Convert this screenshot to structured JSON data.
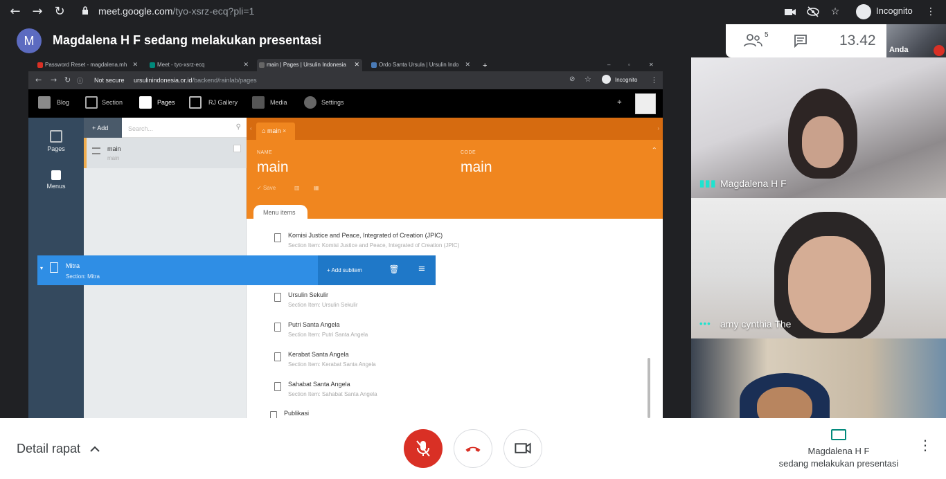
{
  "browser": {
    "url_host": "meet.google.com",
    "url_path": "/tyo-xsrz-ecq?pli=1",
    "incognito_label": "Incognito",
    "icons": [
      "back-icon",
      "forward-icon",
      "reload-icon",
      "lock-icon",
      "camera-icon",
      "eye-off-icon",
      "star-icon",
      "incognito-icon",
      "kebab-icon"
    ]
  },
  "meet": {
    "avatar_letter": "M",
    "title": "Magdalena H F sedang melakukan presentasi",
    "people_count": "5",
    "clock": "13.42",
    "self_label": "Anda",
    "participants": [
      {
        "name": "Magdalena H F"
      },
      {
        "name": "amy cynthia The"
      },
      {
        "name": ""
      }
    ],
    "bottom": {
      "details_label": "Detail rapat",
      "presenter_name": "Magdalena H F",
      "presenter_sub": "sedang melakukan presentasi"
    },
    "colors": {
      "mic_off": "#d93025",
      "hangup": "#d93025",
      "accent": "#00897b"
    }
  },
  "shared": {
    "tabs": [
      {
        "label": "Password Reset - magdalena.mh",
        "fav": "#d93025"
      },
      {
        "label": "Meet - tyo-xsrz-ecq",
        "fav": "#00897b"
      },
      {
        "label": "main | Pages | Ursulin Indonesia",
        "fav": "#666666"
      },
      {
        "label": "Ordo Santa Ursula | Ursulin Indo",
        "fav": "#4a7bb7"
      }
    ],
    "address": {
      "not_secure": "Not secure",
      "host": "ursulinindonesia.or.id",
      "path": "/backend/rainlab/pages",
      "incognito": "Incognito"
    },
    "topnav": [
      "Blog",
      "Section",
      "Pages",
      "RJ Gallery",
      "Media",
      "Settings"
    ],
    "sidebar": [
      "Pages",
      "Menus"
    ],
    "list": {
      "add_label": "Add",
      "search_placeholder": "Search...",
      "row_title": "main",
      "row_sub": "main"
    },
    "editor": {
      "tab_label": "main",
      "name_label": "NAME",
      "name_value": "main",
      "code_label": "CODE",
      "code_value": "main",
      "save_label": "Save",
      "menu_items_tab": "Menu items"
    },
    "menu_items": [
      {
        "title": "Komisi Justice and Peace, Integrated of Creation (JPIC)",
        "sub": "Section Item: Komisi Justice and Peace, Integrated of Creation (JPIC)"
      },
      {
        "title": "Mitra",
        "sub": "Section: Mitra",
        "selected": true
      },
      {
        "title": "Ursulin Sekulir",
        "sub": "Section Item: Ursulin Sekulir"
      },
      {
        "title": "Putri Santa Angela",
        "sub": "Section Item: Putri Santa Angela"
      },
      {
        "title": "Kerabat Santa Angela",
        "sub": "Section Item: Kerabat Santa Angela"
      },
      {
        "title": "Sahabat Santa Angela",
        "sub": "Section Item: Sahabat Santa Angela"
      },
      {
        "title": "Publikasi",
        "sub": ""
      }
    ],
    "add_subitem_label": "Add subitem"
  }
}
